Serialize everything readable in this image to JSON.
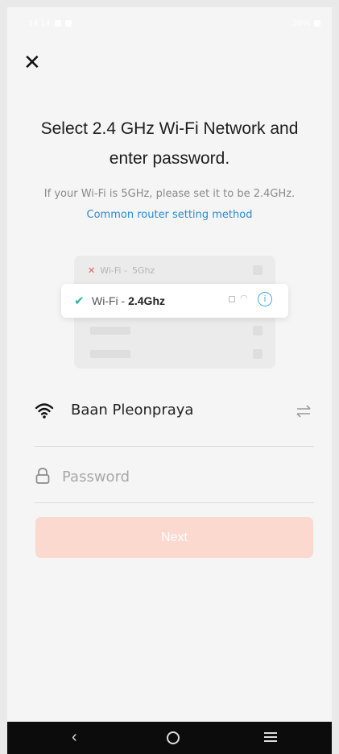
{
  "status_bar": {
    "time": "14:14",
    "battery": "39%"
  },
  "header": {
    "close_icon": "close-icon",
    "close_glyph": "✕"
  },
  "main": {
    "title": "Select 2.4 GHz Wi-Fi Network and enter password.",
    "subtitle": "If your Wi-Fi is 5GHz, please set it to be 2.4GHz.",
    "router_link": "Common router setting method"
  },
  "illustration": {
    "wifi_5": {
      "prefix": "Wi-Fi - ",
      "band": "5Ghz",
      "mark": "✕"
    },
    "wifi_24": {
      "prefix": "Wi-Fi - ",
      "band": "2.4Ghz",
      "mark": "✔"
    }
  },
  "form": {
    "network_name": "Baan Pleonpraya",
    "password_placeholder": "Password",
    "password_value": "",
    "next_label": "Next"
  },
  "nav": {
    "back_glyph": "‹"
  },
  "colors": {
    "accent": "#2b8bd4",
    "button_disabled": "#fbd9ce",
    "check": "#2bb5a8",
    "error": "#e06060"
  },
  "icons": [
    "close-icon",
    "wifi-icon",
    "switch-network-icon",
    "lock-icon",
    "info-icon",
    "check-icon",
    "back-icon",
    "home-icon",
    "menu-icon"
  ]
}
